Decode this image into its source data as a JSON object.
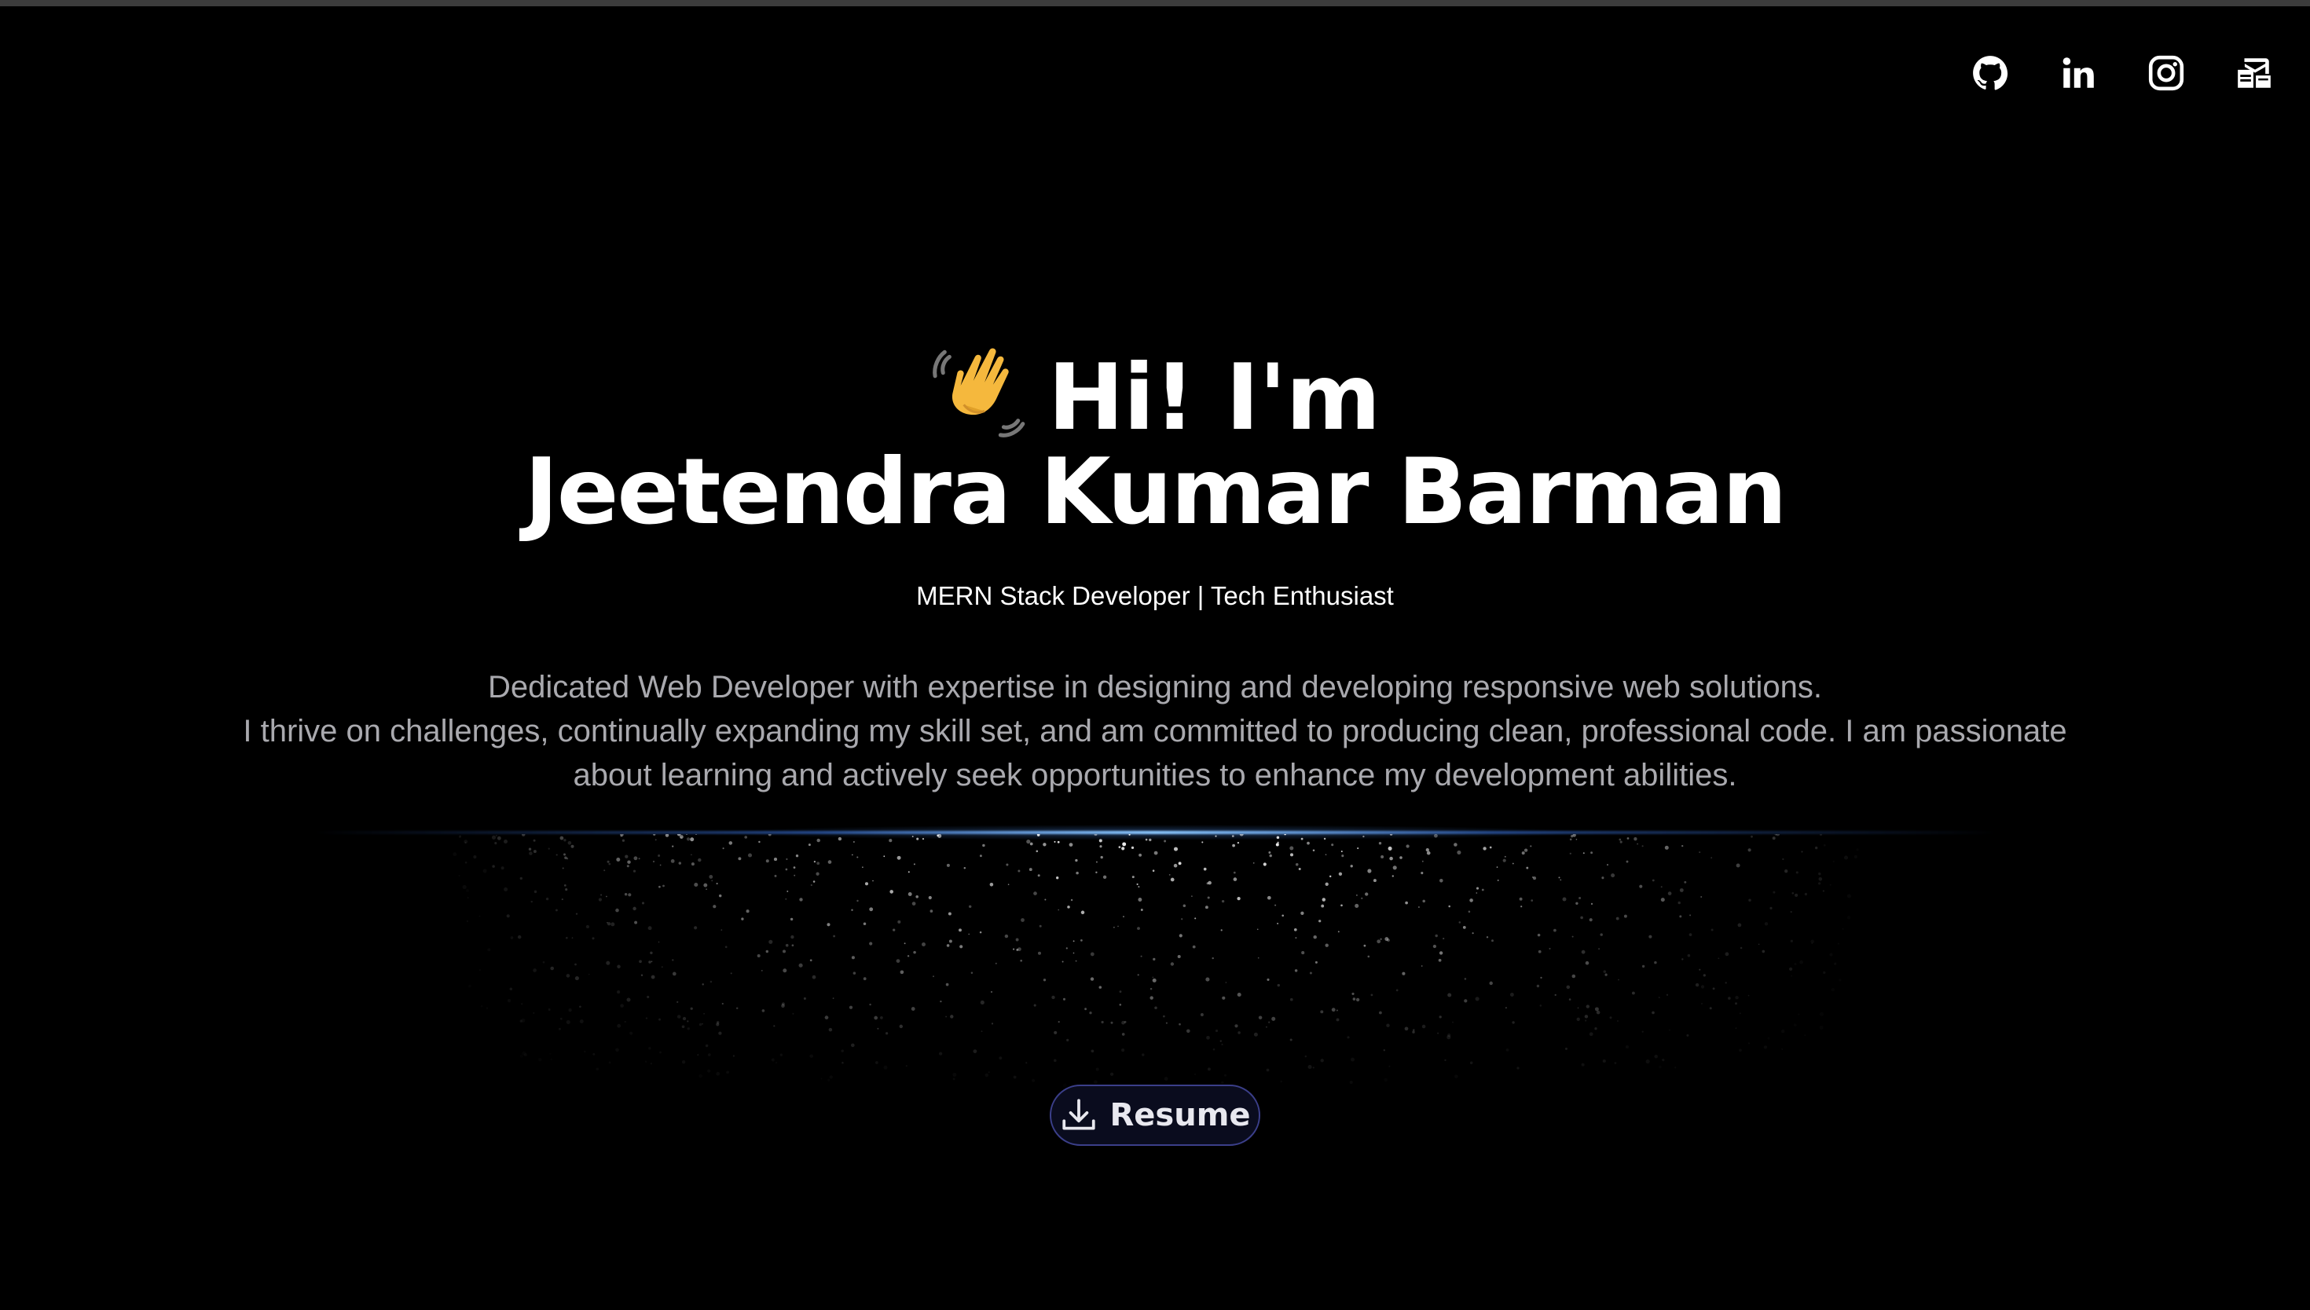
{
  "header": {
    "social_links": [
      {
        "name": "github",
        "icon": "github-icon"
      },
      {
        "name": "linkedin",
        "icon": "linkedin-icon"
      },
      {
        "name": "instagram",
        "icon": "instagram-icon"
      },
      {
        "name": "contact",
        "icon": "contact-card-icon"
      }
    ]
  },
  "hero": {
    "wave_icon": "waving-hand-icon",
    "greeting": "Hi! I'm",
    "name": "Jeetendra Kumar Barman",
    "role": "MERN Stack Developer | Tech Enthusiast",
    "bio_lines": [
      "Dedicated Web Developer with expertise in designing and developing responsive web solutions.",
      "I thrive on challenges, continually expanding my skill set, and am committed to producing clean, professional code. I am passionate",
      "about learning and actively seek opportunities to enhance my development abilities."
    ]
  },
  "resume_button": {
    "label": "Resume",
    "icon": "download-icon"
  },
  "colors": {
    "background": "#000000",
    "text": "#ffffff",
    "muted_text": "#a9a9ae",
    "accent_glow": "#5aa0ff",
    "button_border": "#3b3f8a"
  }
}
